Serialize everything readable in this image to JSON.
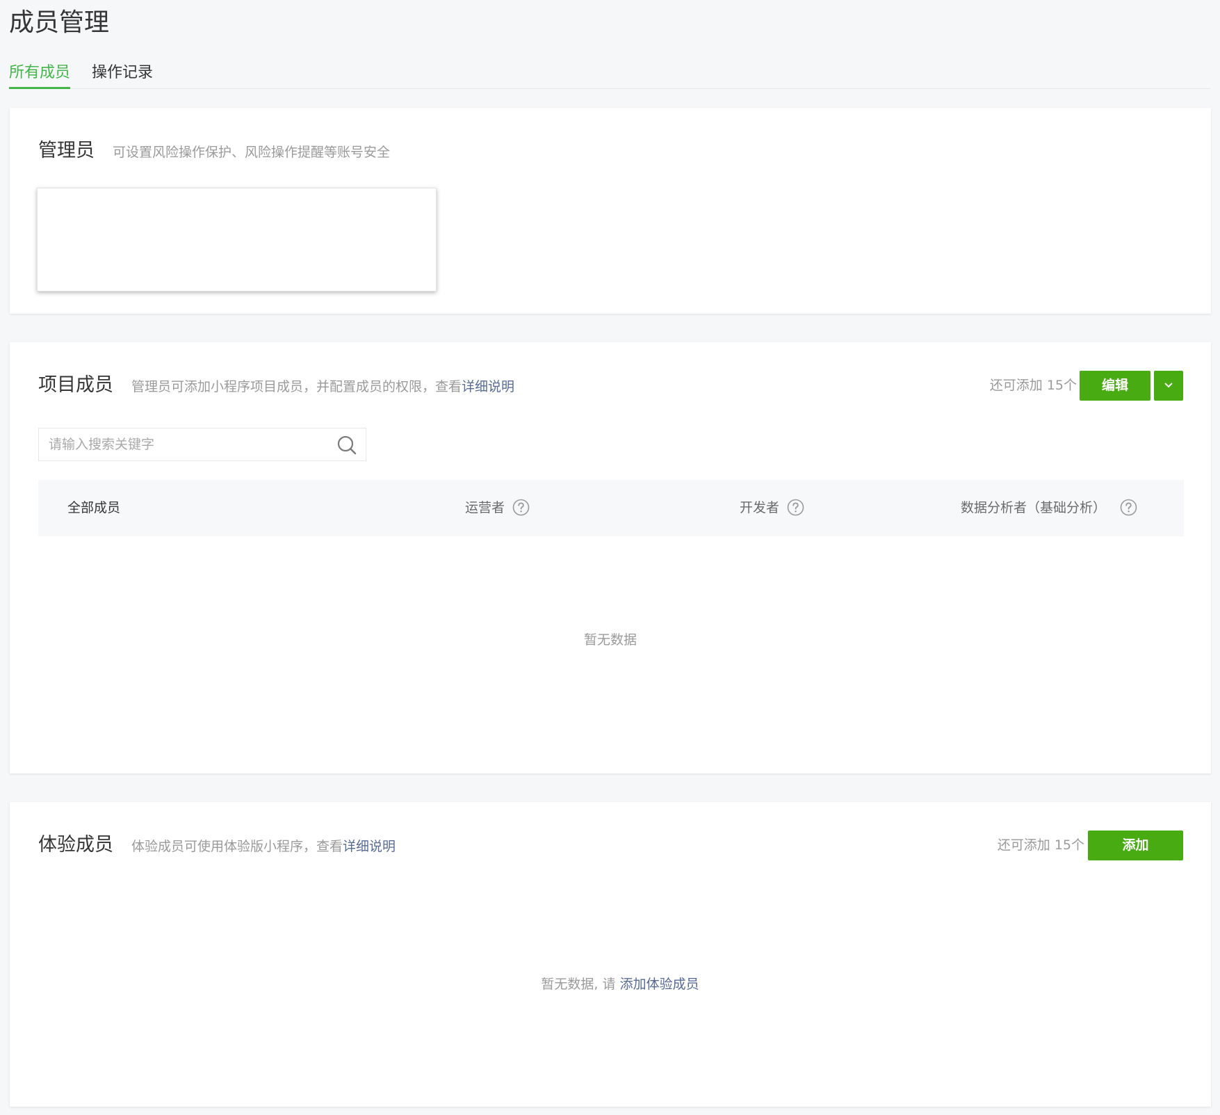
{
  "page": {
    "title": "成员管理"
  },
  "tabs": [
    {
      "label": "所有成员",
      "active": true
    },
    {
      "label": "操作记录",
      "active": false
    }
  ],
  "admin": {
    "title": "管理员",
    "description": "可设置风险操作保护、风险操作提醒等账号安全"
  },
  "project": {
    "title": "项目成员",
    "description": "管理员可添加小程序项目成员，并配置成员的权限，查看",
    "description_link": "详细说明",
    "quota": "还可添加 15个",
    "edit_label": "编辑",
    "dropdown_icon": "chevron-down-icon",
    "search": {
      "placeholder": "请输入搜索关键字",
      "value": ""
    },
    "columns": [
      "全部成员",
      "运营者",
      "开发者",
      "数据分析者（基础分析）"
    ],
    "empty_text": "暂无数据"
  },
  "trial": {
    "title": "体验成员",
    "description": "体验成员可使用体验版小程序，查看",
    "description_link": "详细说明",
    "quota": "还可添加 15个",
    "add_label": "添加",
    "empty_text": "暂无数据, 请",
    "empty_link": "添加体验成员"
  },
  "colors": {
    "accent_green": "#44b549",
    "button_green": "#48ab11",
    "link_blue": "#576b95",
    "page_bg": "#f6f7f9"
  }
}
